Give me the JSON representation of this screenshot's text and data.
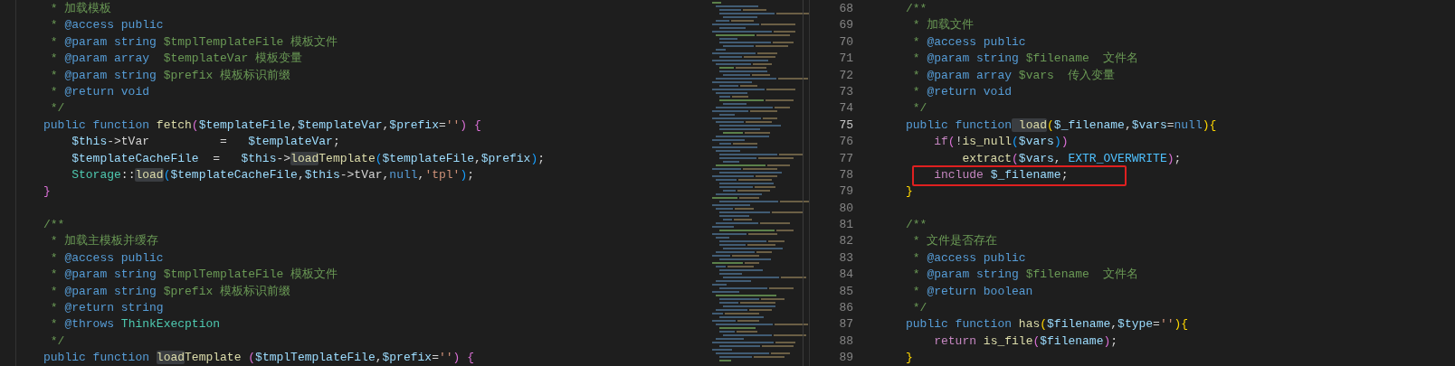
{
  "left_editor": {
    "lines": [
      {
        "kind": "code",
        "tokens": [
          {
            "kind": "c",
            "text": " * 加载模板"
          }
        ]
      },
      {
        "kind": "code",
        "tokens": [
          {
            "kind": "c",
            "text": " * "
          },
          {
            "kind": "dt",
            "text": "@access public"
          }
        ]
      },
      {
        "kind": "code",
        "tokens": [
          {
            "kind": "c",
            "text": " * "
          },
          {
            "kind": "dt",
            "text": "@param string"
          },
          {
            "kind": "c",
            "text": " $tmplTemplateFile 模板文件"
          }
        ]
      },
      {
        "kind": "code",
        "tokens": [
          {
            "kind": "c",
            "text": " * "
          },
          {
            "kind": "dt",
            "text": "@param array"
          },
          {
            "kind": "c",
            "text": "  $templateVar 模板变量"
          }
        ]
      },
      {
        "kind": "code",
        "tokens": [
          {
            "kind": "c",
            "text": " * "
          },
          {
            "kind": "dt",
            "text": "@param string"
          },
          {
            "kind": "c",
            "text": " $prefix 模板标识前缀"
          }
        ]
      },
      {
        "kind": "code",
        "tokens": [
          {
            "kind": "c",
            "text": " * "
          },
          {
            "kind": "dt",
            "text": "@return void"
          }
        ]
      },
      {
        "kind": "code",
        "tokens": [
          {
            "kind": "c",
            "text": " */"
          }
        ]
      },
      {
        "kind": "code",
        "tokens": [
          {
            "kind": "kw",
            "text": "public function "
          },
          {
            "kind": "fn",
            "text": "fetch"
          },
          {
            "kind": "b2",
            "text": "("
          },
          {
            "kind": "var",
            "text": "$templateFile"
          },
          {
            "kind": "op",
            "text": ","
          },
          {
            "kind": "var",
            "text": "$templateVar"
          },
          {
            "kind": "op",
            "text": ","
          },
          {
            "kind": "var",
            "text": "$prefix"
          },
          {
            "kind": "op",
            "text": "="
          },
          {
            "kind": "str",
            "text": "''"
          },
          {
            "kind": "b2",
            "text": ") {"
          }
        ]
      },
      {
        "kind": "code",
        "tokens": [
          {
            "kind": "var",
            "text": "    $this"
          },
          {
            "kind": "op",
            "text": "->tVar          =   "
          },
          {
            "kind": "var",
            "text": "$templateVar"
          },
          {
            "kind": "op",
            "text": ";"
          }
        ]
      },
      {
        "kind": "code",
        "tokens": [
          {
            "kind": "var",
            "text": "    $templateCacheFile"
          },
          {
            "kind": "op",
            "text": "  =   "
          },
          {
            "kind": "var",
            "text": "$this"
          },
          {
            "kind": "op",
            "text": "->"
          },
          {
            "kind": "match",
            "text": "load"
          },
          {
            "kind": "fn",
            "text": "Template"
          },
          {
            "kind": "b3",
            "text": "("
          },
          {
            "kind": "var",
            "text": "$templateFile"
          },
          {
            "kind": "op",
            "text": ","
          },
          {
            "kind": "var",
            "text": "$prefix"
          },
          {
            "kind": "b3",
            "text": ")"
          },
          {
            "kind": "op",
            "text": ";"
          }
        ]
      },
      {
        "kind": "code",
        "tokens": [
          {
            "kind": "cls",
            "text": "    Storage"
          },
          {
            "kind": "op",
            "text": "::"
          },
          {
            "kind": "match",
            "text": "load"
          },
          {
            "kind": "b3",
            "text": "("
          },
          {
            "kind": "var",
            "text": "$templateCacheFile"
          },
          {
            "kind": "op",
            "text": ","
          },
          {
            "kind": "var",
            "text": "$this"
          },
          {
            "kind": "op",
            "text": "->tVar,"
          },
          {
            "kind": "kw",
            "text": "null"
          },
          {
            "kind": "op",
            "text": ","
          },
          {
            "kind": "str",
            "text": "'tpl'"
          },
          {
            "kind": "b3",
            "text": ")"
          },
          {
            "kind": "op",
            "text": ";"
          }
        ]
      },
      {
        "kind": "code",
        "tokens": [
          {
            "kind": "b2",
            "text": "}"
          }
        ]
      },
      {
        "kind": "blank"
      },
      {
        "kind": "code",
        "tokens": [
          {
            "kind": "c",
            "text": "/**"
          }
        ]
      },
      {
        "kind": "code",
        "tokens": [
          {
            "kind": "c",
            "text": " * 加载主模板并缓存"
          }
        ]
      },
      {
        "kind": "code",
        "tokens": [
          {
            "kind": "c",
            "text": " * "
          },
          {
            "kind": "dt",
            "text": "@access public"
          }
        ]
      },
      {
        "kind": "code",
        "tokens": [
          {
            "kind": "c",
            "text": " * "
          },
          {
            "kind": "dt",
            "text": "@param string"
          },
          {
            "kind": "c",
            "text": " $tmplTemplateFile 模板文件"
          }
        ]
      },
      {
        "kind": "code",
        "tokens": [
          {
            "kind": "c",
            "text": " * "
          },
          {
            "kind": "dt",
            "text": "@param string"
          },
          {
            "kind": "c",
            "text": " $prefix 模板标识前缀"
          }
        ]
      },
      {
        "kind": "code",
        "tokens": [
          {
            "kind": "c",
            "text": " * "
          },
          {
            "kind": "dt",
            "text": "@return string"
          }
        ]
      },
      {
        "kind": "code",
        "tokens": [
          {
            "kind": "c",
            "text": " * "
          },
          {
            "kind": "dt",
            "text": "@throws "
          },
          {
            "kind": "cls",
            "text": "ThinkExecption"
          }
        ]
      },
      {
        "kind": "code",
        "tokens": [
          {
            "kind": "c",
            "text": " */"
          }
        ]
      },
      {
        "kind": "code",
        "tokens": [
          {
            "kind": "kw",
            "text": "public function "
          },
          {
            "kind": "match",
            "text": "load"
          },
          {
            "kind": "fn",
            "text": "Template "
          },
          {
            "kind": "b2",
            "text": "("
          },
          {
            "kind": "var",
            "text": "$tmplTemplateFile"
          },
          {
            "kind": "op",
            "text": ","
          },
          {
            "kind": "var",
            "text": "$prefix"
          },
          {
            "kind": "op",
            "text": "="
          },
          {
            "kind": "str",
            "text": "''"
          },
          {
            "kind": "b2",
            "text": ") {"
          }
        ]
      }
    ]
  },
  "right_editor": {
    "lines": [
      {
        "number": "68",
        "current": false,
        "boxed": false,
        "tokens": [
          {
            "kind": "c",
            "text": "/**"
          }
        ]
      },
      {
        "number": "69",
        "current": false,
        "boxed": false,
        "tokens": [
          {
            "kind": "c",
            "text": " * 加载文件"
          }
        ]
      },
      {
        "number": "70",
        "current": false,
        "boxed": false,
        "tokens": [
          {
            "kind": "c",
            "text": " * "
          },
          {
            "kind": "dt",
            "text": "@access public"
          }
        ]
      },
      {
        "number": "71",
        "current": false,
        "boxed": false,
        "tokens": [
          {
            "kind": "c",
            "text": " * "
          },
          {
            "kind": "dt",
            "text": "@param string"
          },
          {
            "kind": "c",
            "text": " $filename  文件名"
          }
        ]
      },
      {
        "number": "72",
        "current": false,
        "boxed": false,
        "tokens": [
          {
            "kind": "c",
            "text": " * "
          },
          {
            "kind": "dt",
            "text": "@param array"
          },
          {
            "kind": "c",
            "text": " $vars  传入变量"
          }
        ]
      },
      {
        "number": "73",
        "current": false,
        "boxed": false,
        "tokens": [
          {
            "kind": "c",
            "text": " * "
          },
          {
            "kind": "dt",
            "text": "@return void"
          }
        ]
      },
      {
        "number": "74",
        "current": false,
        "boxed": false,
        "tokens": [
          {
            "kind": "c",
            "text": " */"
          }
        ]
      },
      {
        "number": "75",
        "current": true,
        "boxed": false,
        "tokens": [
          {
            "kind": "kw",
            "text": "public function"
          },
          {
            "kind": "match",
            "text": " load"
          },
          {
            "kind": "b1",
            "text": "("
          },
          {
            "kind": "var",
            "text": "$_filename"
          },
          {
            "kind": "op",
            "text": ","
          },
          {
            "kind": "var",
            "text": "$vars"
          },
          {
            "kind": "op",
            "text": "="
          },
          {
            "kind": "kw",
            "text": "null"
          },
          {
            "kind": "b1",
            "text": "){"
          }
        ]
      },
      {
        "number": "76",
        "current": false,
        "boxed": false,
        "tokens": [
          {
            "kind": "ctl",
            "text": "    if"
          },
          {
            "kind": "b2",
            "text": "("
          },
          {
            "kind": "op",
            "text": "!"
          },
          {
            "kind": "fn",
            "text": "is_null"
          },
          {
            "kind": "b3",
            "text": "("
          },
          {
            "kind": "var",
            "text": "$vars"
          },
          {
            "kind": "b3",
            "text": ")"
          },
          {
            "kind": "b2",
            "text": ")"
          }
        ]
      },
      {
        "number": "77",
        "current": false,
        "boxed": false,
        "tokens": [
          {
            "kind": "fn",
            "text": "        extract"
          },
          {
            "kind": "b2",
            "text": "("
          },
          {
            "kind": "var",
            "text": "$vars"
          },
          {
            "kind": "op",
            "text": ", "
          },
          {
            "kind": "const",
            "text": "EXTR_OVERWRITE"
          },
          {
            "kind": "b2",
            "text": ")"
          },
          {
            "kind": "op",
            "text": ";"
          }
        ]
      },
      {
        "number": "78",
        "current": false,
        "boxed": true,
        "tokens": [
          {
            "kind": "ctl",
            "text": "    include "
          },
          {
            "kind": "var",
            "text": "$_filename"
          },
          {
            "kind": "op",
            "text": ";"
          }
        ]
      },
      {
        "number": "79",
        "current": false,
        "boxed": false,
        "tokens": [
          {
            "kind": "b1",
            "text": "}"
          }
        ]
      },
      {
        "number": "80",
        "current": false,
        "boxed": false
      },
      {
        "number": "81",
        "current": false,
        "boxed": false,
        "tokens": [
          {
            "kind": "c",
            "text": "/**"
          }
        ]
      },
      {
        "number": "82",
        "current": false,
        "boxed": false,
        "tokens": [
          {
            "kind": "c",
            "text": " * 文件是否存在"
          }
        ]
      },
      {
        "number": "83",
        "current": false,
        "boxed": false,
        "tokens": [
          {
            "kind": "c",
            "text": " * "
          },
          {
            "kind": "dt",
            "text": "@access public"
          }
        ]
      },
      {
        "number": "84",
        "current": false,
        "boxed": false,
        "tokens": [
          {
            "kind": "c",
            "text": " * "
          },
          {
            "kind": "dt",
            "text": "@param string"
          },
          {
            "kind": "c",
            "text": " $filename  文件名"
          }
        ]
      },
      {
        "number": "85",
        "current": false,
        "boxed": false,
        "tokens": [
          {
            "kind": "c",
            "text": " * "
          },
          {
            "kind": "dt",
            "text": "@return boolean"
          }
        ]
      },
      {
        "number": "86",
        "current": false,
        "boxed": false,
        "tokens": [
          {
            "kind": "c",
            "text": " */"
          }
        ]
      },
      {
        "number": "87",
        "current": false,
        "boxed": false,
        "tokens": [
          {
            "kind": "kw",
            "text": "public function "
          },
          {
            "kind": "fn",
            "text": "has"
          },
          {
            "kind": "b1",
            "text": "("
          },
          {
            "kind": "var",
            "text": "$filename"
          },
          {
            "kind": "op",
            "text": ","
          },
          {
            "kind": "var",
            "text": "$type"
          },
          {
            "kind": "op",
            "text": "="
          },
          {
            "kind": "str",
            "text": "''"
          },
          {
            "kind": "b1",
            "text": "){"
          }
        ]
      },
      {
        "number": "88",
        "current": false,
        "boxed": false,
        "tokens": [
          {
            "kind": "ctl",
            "text": "    return "
          },
          {
            "kind": "fn",
            "text": "is_file"
          },
          {
            "kind": "b2",
            "text": "("
          },
          {
            "kind": "var",
            "text": "$filename"
          },
          {
            "kind": "b2",
            "text": ")"
          },
          {
            "kind": "op",
            "text": ";"
          }
        ]
      },
      {
        "number": "89",
        "current": false,
        "boxed": false,
        "tokens": [
          {
            "kind": "b1",
            "text": "}"
          }
        ]
      }
    ]
  }
}
